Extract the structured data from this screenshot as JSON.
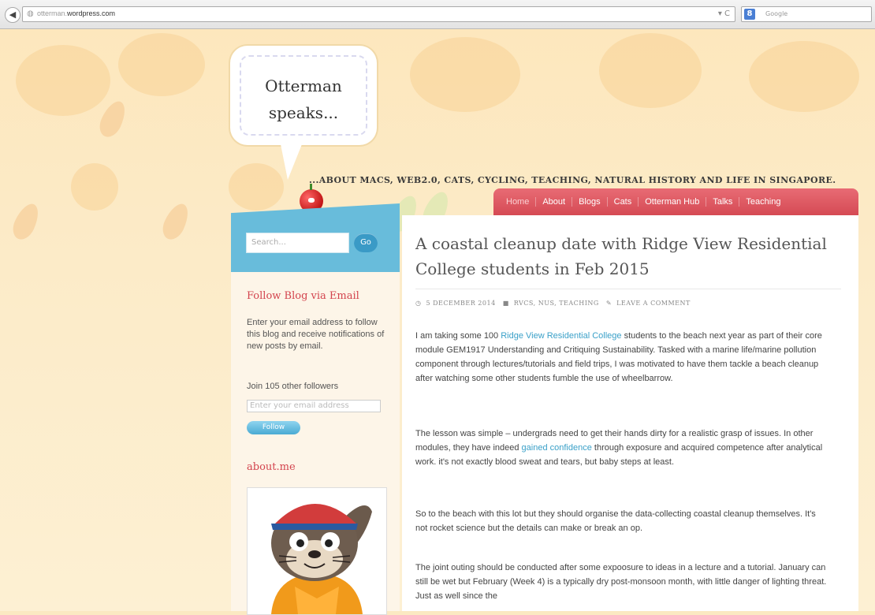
{
  "browser": {
    "url_prefix": "otterman.",
    "url_domain": "wordpress.com",
    "search_placeholder": "Google",
    "search_engine_icon": "google-icon"
  },
  "site": {
    "title_line1": "Otterman",
    "title_line2": "speaks...",
    "tagline": "...ABOUT MACS, WEB2.0, CATS, CYCLING, TEACHING, NATURAL HISTORY AND LIFE IN SINGAPORE."
  },
  "nav": {
    "items": [
      "Home",
      "About",
      "Blogs",
      "Cats",
      "Otterman Hub",
      "Talks",
      "Teaching"
    ]
  },
  "sidebar": {
    "search_placeholder": "Search...",
    "search_button": "Go",
    "follow_heading": "Follow Blog via Email",
    "follow_text": "Enter your email address to follow this blog and receive notifications of new posts by email.",
    "followers_text": "Join 105 other followers",
    "email_placeholder": "Enter your email address",
    "follow_button": "Follow",
    "about_heading": "about.me"
  },
  "post": {
    "title": "A coastal cleanup date with Ridge View Residential College students in Feb 2015",
    "meta": {
      "date": "5 DECEMBER 2014",
      "categories": "RVCS, NUS, TEACHING",
      "comment": "LEAVE A COMMENT"
    },
    "p1_a": "I am taking some 100 ",
    "p1_link": "Ridge View Residential College",
    "p1_b": " students to the beach next year as part of their core module GEM1917 Understanding and Critiquing Sustainability. Tasked with a marine life/marine pollution component through lectures/tutorials and field trips, I was motivated to have them tackle a beach cleanup after watching some other students fumble the use of wheelbarrow.",
    "p2_a": "The lesson was simple – undergrads need to get their hands dirty for a realistic grasp of issues. In other modules, they have indeed ",
    "p2_link": "gained confidence",
    "p2_b": " through exposure and acquired competence after analytical work. it's not exactly blood sweat and tears, but baby steps at least.",
    "p3": "So to the beach with this lot but they should organise the data-collecting coastal cleanup themselves. It's not rocket science but the details can make or break an op.",
    "p4": "The joint outing should be conducted after some expoosure to ideas in a lecture and a tutorial. January can still be wet but February (Week 4) is a typically dry post-monsoon month, with little danger of lighting threat. Just as well since the"
  }
}
